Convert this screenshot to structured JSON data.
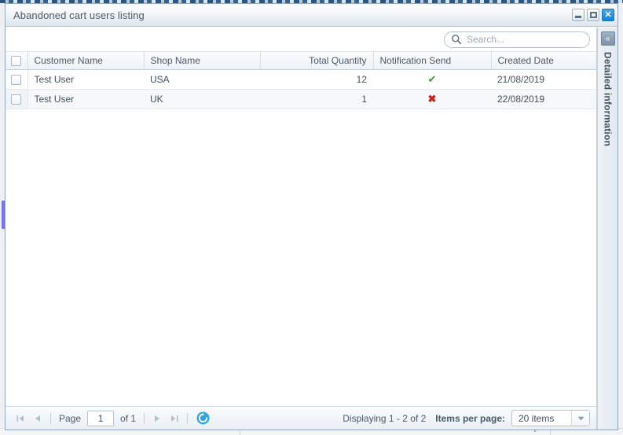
{
  "window": {
    "title": "Abandoned cart users listing",
    "buttons": {
      "minimize": "minimize-button",
      "maximize": "maximize-button",
      "close": "✕"
    }
  },
  "search": {
    "placeholder": "Search...",
    "value": "",
    "icon": "search-icon"
  },
  "grid": {
    "columns": [
      {
        "label": "",
        "key": "select",
        "align": "center"
      },
      {
        "label": "Customer Name",
        "key": "customer_name",
        "align": "left"
      },
      {
        "label": "Shop Name",
        "key": "shop_name",
        "align": "left"
      },
      {
        "label": "Total Quantity",
        "key": "total_quantity",
        "align": "right"
      },
      {
        "label": "Notification Send",
        "key": "notification_send",
        "align": "center"
      },
      {
        "label": "Created Date",
        "key": "created_date",
        "align": "left"
      }
    ],
    "rows": [
      {
        "customer_name": "Test User",
        "shop_name": "USA",
        "total_quantity": "12",
        "notification_send": "✔",
        "notification_state": "sent",
        "created_date": "21/08/2019"
      },
      {
        "customer_name": "Test User",
        "shop_name": "UK",
        "total_quantity": "1",
        "notification_send": "✖",
        "notification_state": "not-sent",
        "created_date": "22/08/2019"
      }
    ]
  },
  "pager": {
    "first_icon": "first-page-icon",
    "prev_icon": "previous-page-icon",
    "page_label": "Page",
    "page_value": "1",
    "of_label": "of 1",
    "next_icon": "next-page-icon",
    "last_icon": "last-page-icon",
    "refresh_icon": "refresh-icon",
    "displaying": "Displaying 1 - 2 of 2",
    "items_per_page_label": "Items per page:",
    "items_per_page_value": "20 items",
    "items_per_page_options": [
      "20 items"
    ]
  },
  "side_panel": {
    "collapse_icon": "«",
    "label": "Detailed information"
  },
  "colors": {
    "accent": "#1384d6",
    "success": "#3c9e34",
    "danger": "#cc2020",
    "header_text": "#4a5a6a",
    "scrollbar_thumb": "#7b6ef0"
  }
}
